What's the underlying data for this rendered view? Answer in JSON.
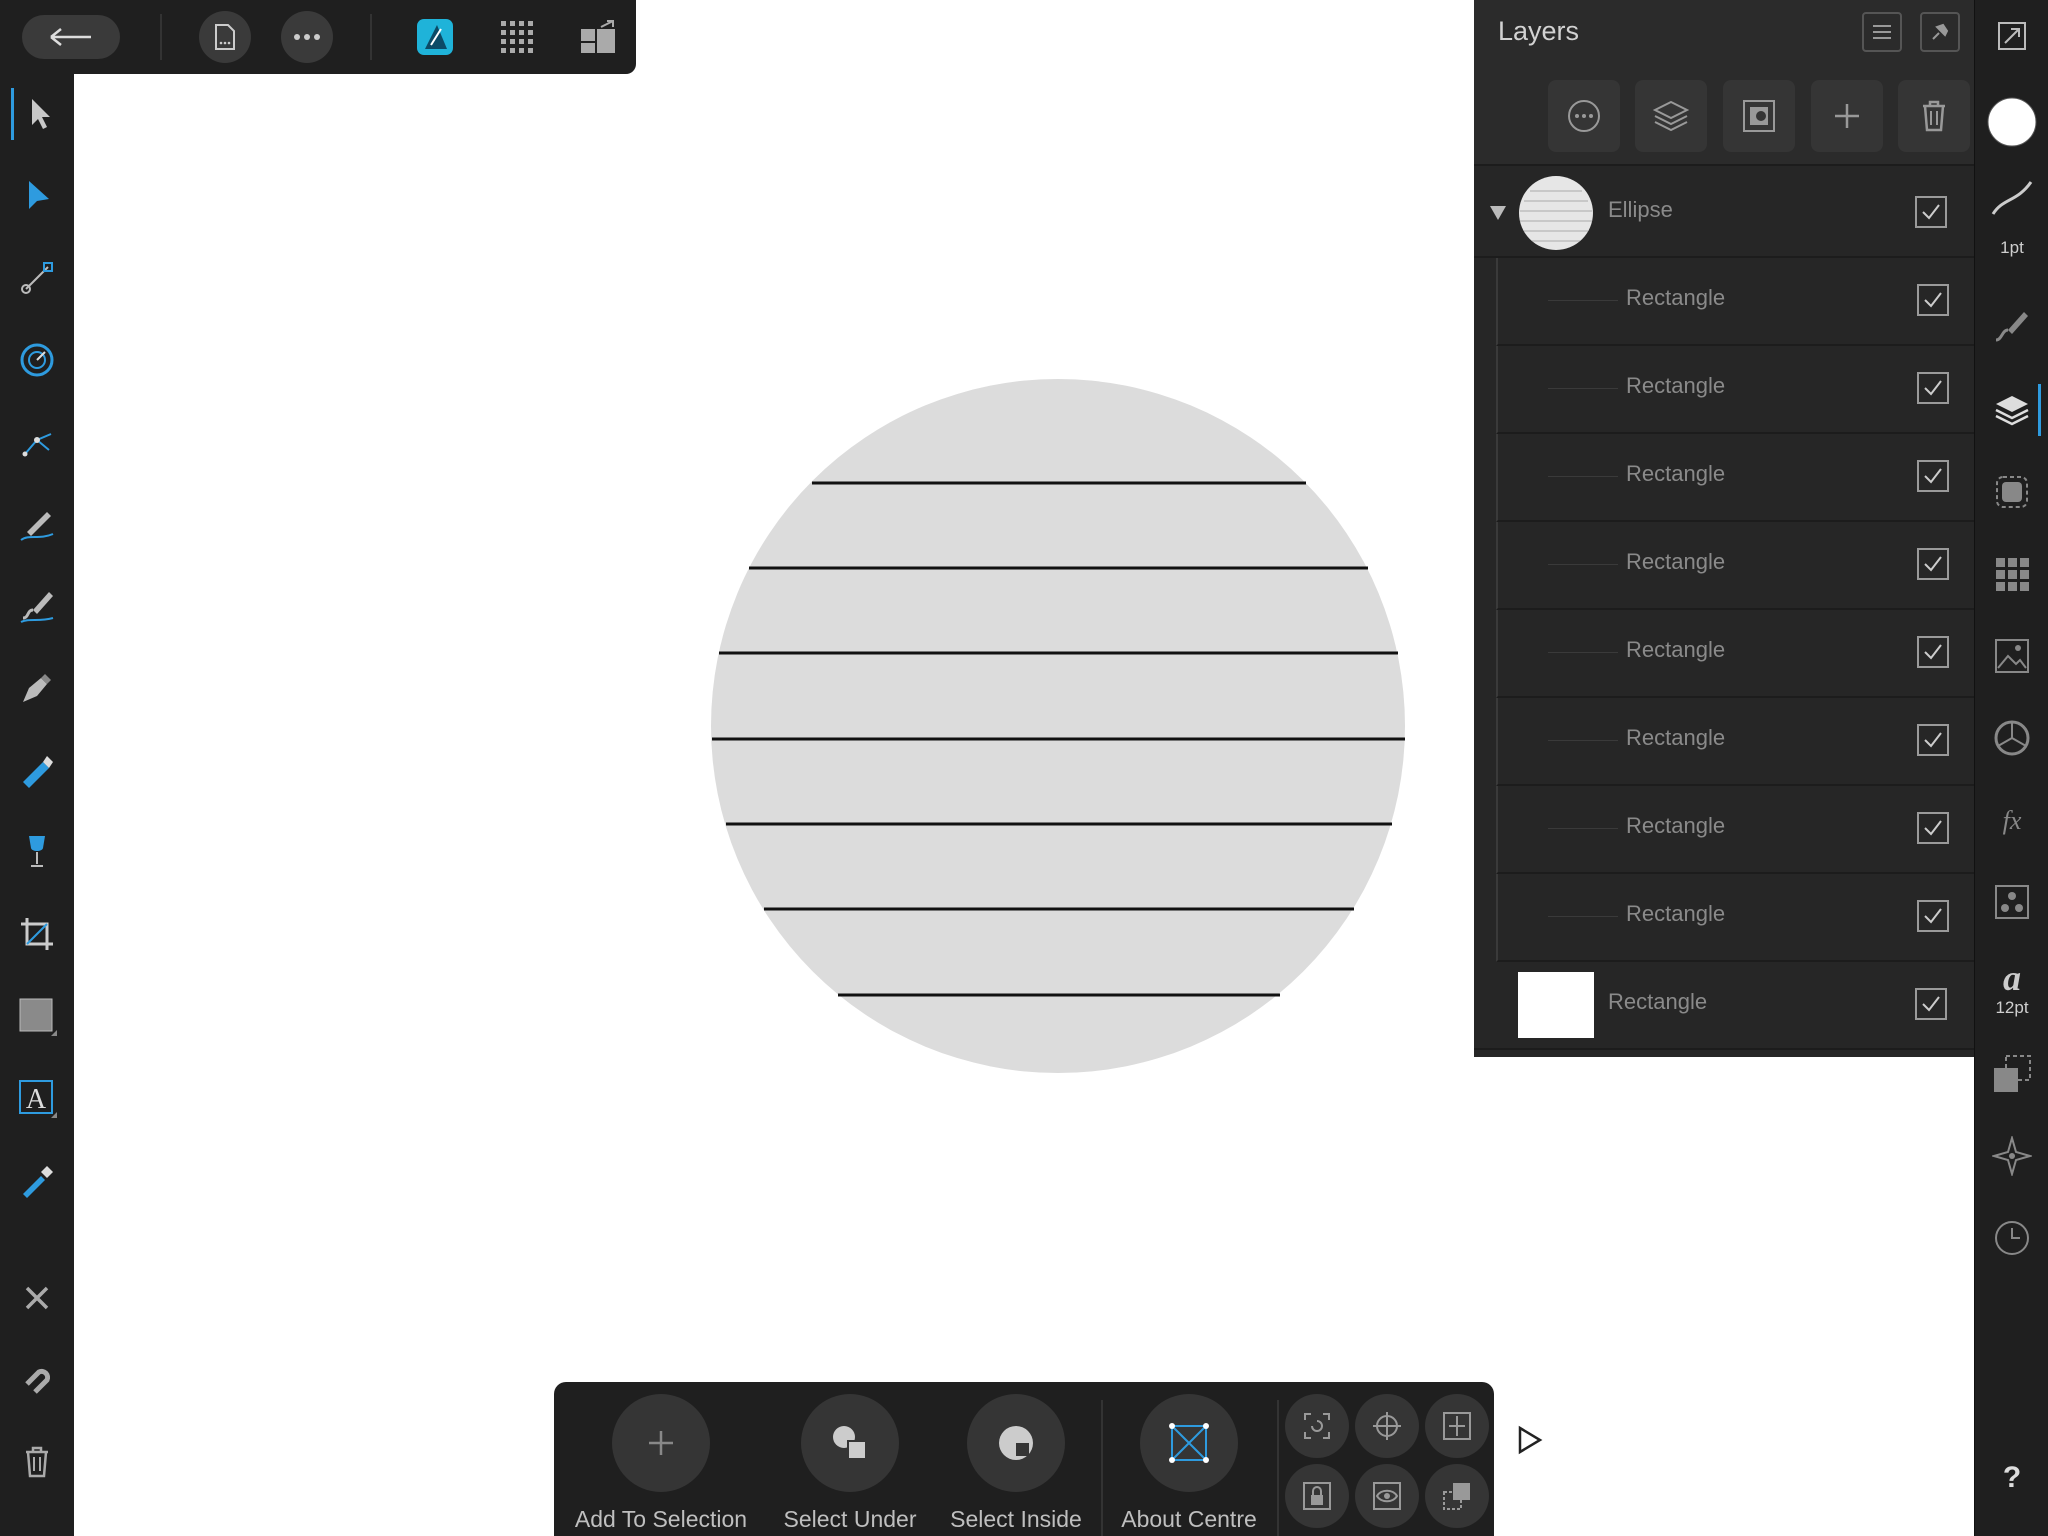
{
  "layers_panel": {
    "title": "Layers",
    "items": [
      {
        "name": "Ellipse",
        "checked": true,
        "expanded": true
      },
      {
        "name": "Rectangle",
        "checked": true
      },
      {
        "name": "Rectangle",
        "checked": true
      },
      {
        "name": "Rectangle",
        "checked": true
      },
      {
        "name": "Rectangle",
        "checked": true
      },
      {
        "name": "Rectangle",
        "checked": true
      },
      {
        "name": "Rectangle",
        "checked": true
      },
      {
        "name": "Rectangle",
        "checked": true
      },
      {
        "name": "Rectangle",
        "checked": true
      },
      {
        "name": "Rectangle",
        "checked": true
      }
    ]
  },
  "studio": {
    "stroke_width_label": "1pt",
    "font_size_label": "12pt",
    "help_label": "?"
  },
  "context_toolbar": {
    "add_to_selection": "Add To Selection",
    "select_under": "Select Under",
    "select_inside": "Select Inside",
    "about_centre": "About Centre"
  },
  "colors": {
    "accent": "#2e9bdf",
    "panel": "#262626",
    "toolbar": "#1f1f1f",
    "ellipse_fill": "#dcdcdc"
  }
}
